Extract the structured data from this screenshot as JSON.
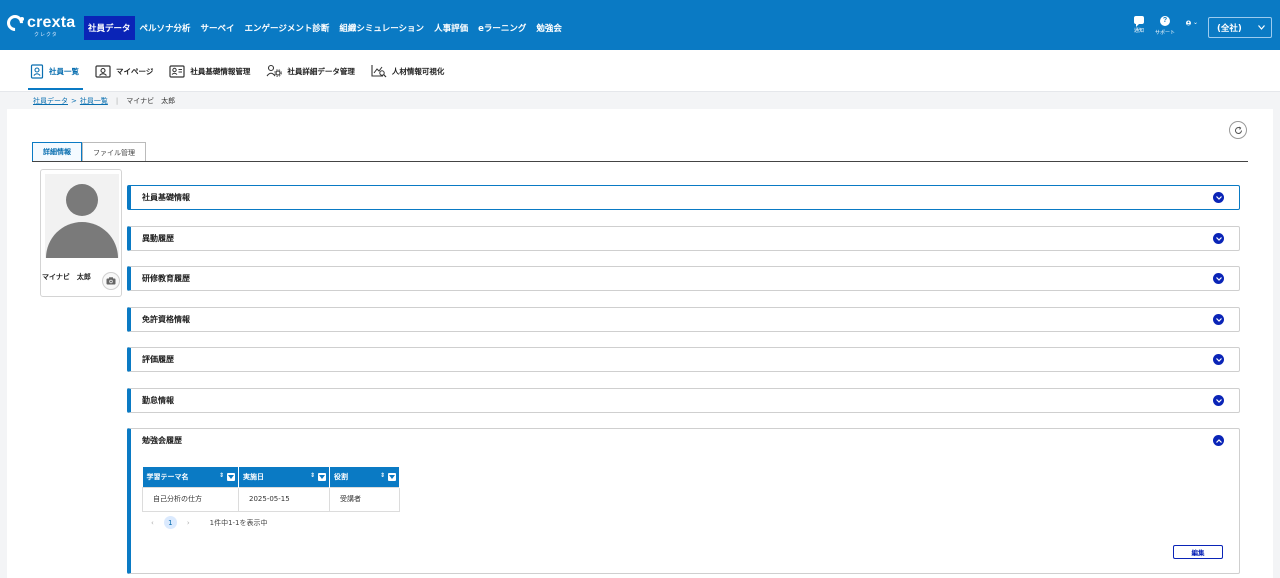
{
  "header": {
    "logo_text": "crexta",
    "logo_sub": "クレクタ",
    "nav": [
      {
        "label": "社員データ",
        "active": true
      },
      {
        "label": "ペルソナ分析"
      },
      {
        "label": "サーベイ"
      },
      {
        "label": "エンゲージメント診断"
      },
      {
        "label": "組織シミュレーション"
      },
      {
        "label": "人事評価"
      },
      {
        "label": "eラーニング"
      },
      {
        "label": "勉強会"
      }
    ],
    "tools": {
      "notice_label": "通知",
      "support_label": "サポート",
      "help_glyph": "?"
    },
    "company_select": "(全社)",
    "accent": "#0a7ac4",
    "active_nav_color": "#0a24b7"
  },
  "subnav": {
    "items": [
      {
        "label": "社員一覧",
        "icon": "id-card-icon",
        "active": true
      },
      {
        "label": "マイページ",
        "icon": "profile-card-icon"
      },
      {
        "label": "社員基礎情報管理",
        "icon": "address-card-icon"
      },
      {
        "label": "社員詳細データ管理",
        "icon": "user-gear-icon"
      },
      {
        "label": "人材情報可視化",
        "icon": "chart-search-icon"
      }
    ]
  },
  "breadcrumb": {
    "link1": "社員データ",
    "sep1": ">",
    "link2": "社員一覧",
    "sep2": "|",
    "current": "マイナビ　太郎"
  },
  "tabs": [
    {
      "label": "詳細情報",
      "active": true
    },
    {
      "label": "ファイル管理"
    }
  ],
  "profile": {
    "name": "マイナビ　太郎"
  },
  "sections": [
    {
      "title": "社員基礎情報"
    },
    {
      "title": "異動履歴"
    },
    {
      "title": "研修教育履歴"
    },
    {
      "title": "免許資格情報"
    },
    {
      "title": "評価履歴"
    },
    {
      "title": "勤怠情報"
    }
  ],
  "open_section": {
    "title": "勉強会履歴",
    "table": {
      "headers": [
        "学習テーマ名",
        "実施日",
        "役割"
      ],
      "rows": [
        [
          "自己分析の仕方",
          "2025-05-15",
          "受講者"
        ]
      ]
    },
    "pager": {
      "prev": "‹",
      "page": "1",
      "next": "›",
      "info": "1件中1-1を表示中"
    },
    "edit_label": "編集"
  }
}
